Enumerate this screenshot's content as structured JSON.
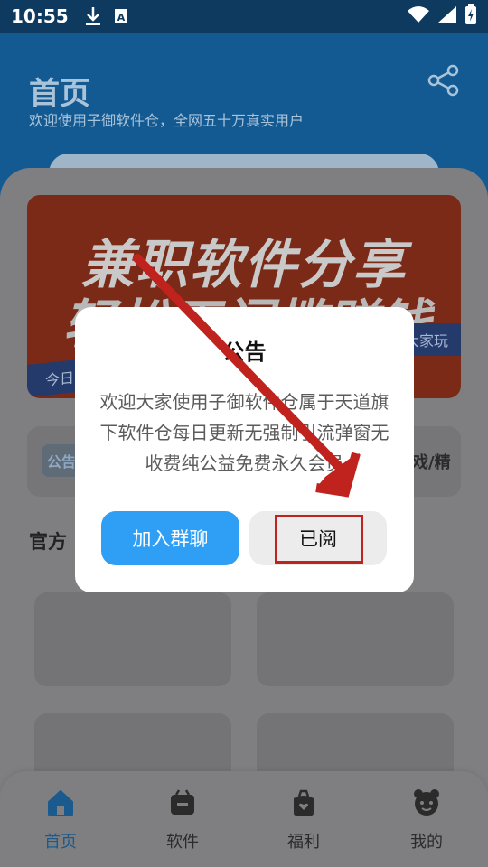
{
  "status_bar": {
    "time": "10:55",
    "download_icon": "download-icon",
    "a_icon": "font-a-icon",
    "wifi_icon": "wifi-icon",
    "signal_icon": "signal-icon",
    "battery_icon": "battery-charging-icon"
  },
  "header": {
    "title": "首页",
    "subtitle": "欢迎使用子御软件仓，全网五十万真实用户",
    "share_icon": "share-icon"
  },
  "banner": {
    "line1": "兼职软件分享",
    "line2": "轻松无门槛赚钱",
    "tag_left": "今日",
    "tag_right": "大家玩"
  },
  "notice_bar": {
    "badge": "公告",
    "tail_text": "戏/精"
  },
  "section": {
    "title": "官方"
  },
  "dialog": {
    "title": "公告",
    "body": "欢迎大家使用子御软件仓属于天道旗下软件仓每日更新无强制引流弹窗无收费纯公益免费永久会员",
    "join_button": "加入群聊",
    "read_button": "已阅"
  },
  "bottom_nav": {
    "items": [
      {
        "label": "首页",
        "icon": "home-icon",
        "active": true
      },
      {
        "label": "软件",
        "icon": "app-box-icon",
        "active": false
      },
      {
        "label": "福利",
        "icon": "gift-bag-icon",
        "active": false
      },
      {
        "label": "我的",
        "icon": "profile-icon",
        "active": false
      }
    ]
  },
  "colors": {
    "accent": "#2f9ff5",
    "header_blue": "#145a92",
    "annotation_red": "#c0221e",
    "dim_overlay": "#7f7f81"
  }
}
